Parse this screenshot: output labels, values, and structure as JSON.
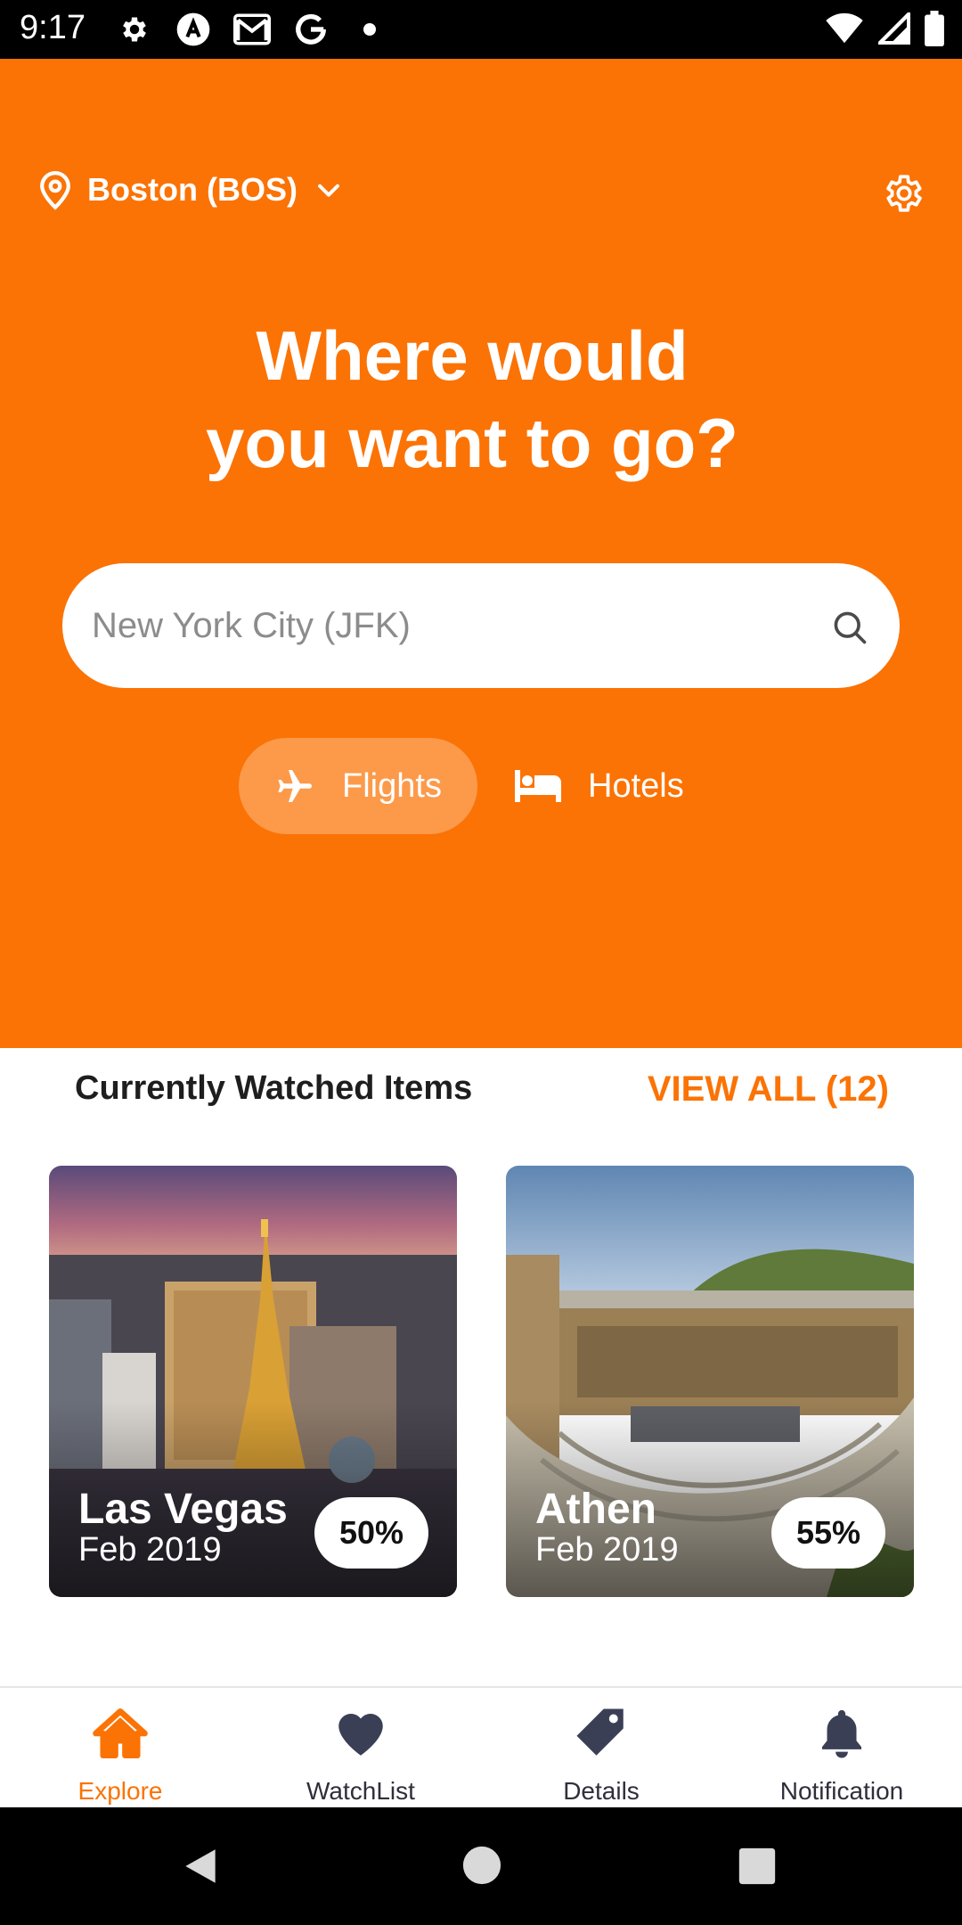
{
  "status_bar": {
    "time": "9:17",
    "icons": [
      "settings-icon",
      "a-icon",
      "gmail-icon",
      "google-icon",
      "dot-icon",
      "wifi-icon",
      "signal-icon",
      "battery-icon"
    ]
  },
  "header": {
    "location": "Boston (BOS)",
    "headline_line1": "Where would",
    "headline_line2": "you want to go?",
    "search": {
      "placeholder": "New York City (JFK)",
      "value": ""
    },
    "tabs": [
      {
        "label": "Flights",
        "icon": "plane-icon",
        "selected": true
      },
      {
        "label": "Hotels",
        "icon": "bed-icon",
        "selected": false
      }
    ]
  },
  "watched": {
    "title": "Currently Watched Items",
    "view_all": "VIEW ALL (12)",
    "cards": [
      {
        "destination": "Las Vegas",
        "date": "Feb 2019",
        "percent": "50%"
      },
      {
        "destination": "Athen",
        "date": "Feb 2019",
        "percent": "55%"
      }
    ]
  },
  "bottom_nav": {
    "items": [
      {
        "label": "Explore",
        "icon": "home-icon",
        "active": true
      },
      {
        "label": "WatchList",
        "icon": "heart-icon",
        "active": false
      },
      {
        "label": "Details",
        "icon": "tag-icon",
        "active": false
      },
      {
        "label": "Notification",
        "icon": "bell-icon",
        "active": false
      }
    ]
  },
  "colors": {
    "accent": "#fb7305",
    "text_dark": "#1e1e1e",
    "nav_icon": "#3a3f55"
  }
}
